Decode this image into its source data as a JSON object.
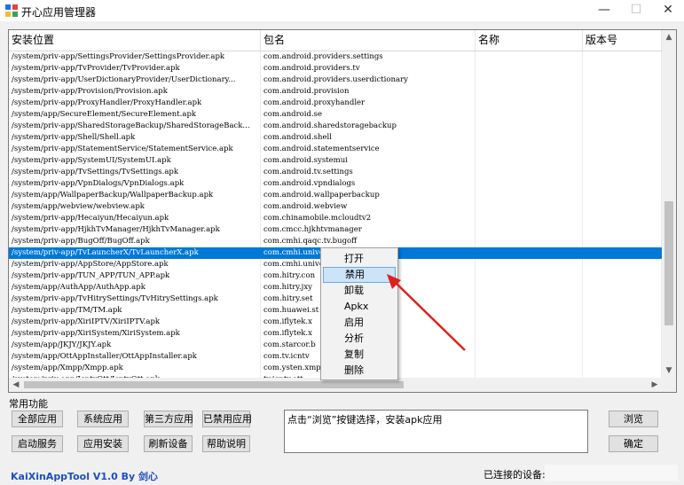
{
  "window": {
    "title": "开心应用管理器",
    "minimize": "—",
    "maximize": "☐",
    "close": "✕",
    "icon": "app-grid-icon"
  },
  "grid": {
    "columns": [
      "安装位置",
      "包名",
      "名称",
      "版本号"
    ],
    "rows": [
      {
        "path": "/system/priv-app/SettingsProvider/SettingsProvider.apk",
        "pkg": "com.android.providers.settings"
      },
      {
        "path": "/system/priv-app/TvProvider/TvProvider.apk",
        "pkg": "com.android.providers.tv"
      },
      {
        "path": "/system/priv-app/UserDictionaryProvider/UserDictionary...",
        "pkg": "com.android.providers.userdictionary"
      },
      {
        "path": "/system/priv-app/Provision/Provision.apk",
        "pkg": "com.android.provision"
      },
      {
        "path": "/system/priv-app/ProxyHandler/ProxyHandler.apk",
        "pkg": "com.android.proxyhandler"
      },
      {
        "path": "/system/app/SecureElement/SecureElement.apk",
        "pkg": "com.android.se"
      },
      {
        "path": "/system/priv-app/SharedStorageBackup/SharedStorageBack...",
        "pkg": "com.android.sharedstoragebackup"
      },
      {
        "path": "/system/priv-app/Shell/Shell.apk",
        "pkg": "com.android.shell"
      },
      {
        "path": "/system/priv-app/StatementService/StatementService.apk",
        "pkg": "com.android.statementservice"
      },
      {
        "path": "/system/priv-app/SystemUI/SystemUI.apk",
        "pkg": "com.android.systemui"
      },
      {
        "path": "/system/priv-app/TvSettings/TvSettings.apk",
        "pkg": "com.android.tv.settings"
      },
      {
        "path": "/system/priv-app/VpnDialogs/VpnDialogs.apk",
        "pkg": "com.android.vpndialogs"
      },
      {
        "path": "/system/app/WallpaperBackup/WallpaperBackup.apk",
        "pkg": "com.android.wallpaperbackup"
      },
      {
        "path": "/system/app/webview/webview.apk",
        "pkg": "com.android.webview"
      },
      {
        "path": "/system/priv-app/Hecaiyun/Hecaiyun.apk",
        "pkg": "com.chinamobile.mcloudtv2"
      },
      {
        "path": "/system/priv-app/HjkhTvManager/HjkhTvManager.apk",
        "pkg": "com.cmcc.hjkhtvmanager"
      },
      {
        "path": "/system/priv-app/BugOff/BugOff.apk",
        "pkg": "com.cmhi.qaqc.tv.bugoff"
      },
      {
        "path": "/system/priv-app/TvLauncherX/TvLauncherX.apk",
        "pkg": "com.cmhi.universalapp.launcher"
      },
      {
        "path": "/system/priv-app/AppStore/AppStore.apk",
        "pkg": "com.cmhi.universalapp.appstore"
      },
      {
        "path": "/system/priv-app/TUN_APP/TUN_APP.apk",
        "pkg": "com.hitry.con"
      },
      {
        "path": "/system/app/AuthApp/AuthApp.apk",
        "pkg": "com.hitry.jxy"
      },
      {
        "path": "/system/priv-app/TvHitrySettings/TvHitrySettings.apk",
        "pkg": "com.hitry.set"
      },
      {
        "path": "/system/priv-app/TM/TM.apk",
        "pkg": "com.huawei.st"
      },
      {
        "path": "/system/priv-app/XiriIPTV/XiriIPTV.apk",
        "pkg": "com.iflytek.x"
      },
      {
        "path": "/system/priv-app/XiriSystem/XiriSystem.apk",
        "pkg": "com.iflytek.x"
      },
      {
        "path": "/system/app/JKJY/JKJY.apk",
        "pkg": "com.starcor.b"
      },
      {
        "path": "/system/app/OttAppInstaller/OttAppInstaller.apk",
        "pkg": "com.tv.icntv"
      },
      {
        "path": "/system/app/Xmpp/Xmpp.apk",
        "pkg": "com.ysten.xmp"
      },
      {
        "path": "/system/priv-app/IcntvOtt/IcntvOtt.apk",
        "pkg": "tv.icntv.ott"
      }
    ],
    "selected_index": 17
  },
  "context_menu": {
    "items": [
      "打开",
      "禁用",
      "卸载",
      "Apkx",
      "启用",
      "分析",
      "复制",
      "删除"
    ],
    "highlighted_index": 1
  },
  "common": {
    "label": "常用功能",
    "btn_all": "全部应用",
    "btn_system": "系统应用",
    "btn_third": "第三方应用",
    "btn_disabled": "已禁用应用",
    "btn_start_service": "启动服务",
    "btn_install": "应用安装",
    "btn_refresh": "刷新设备",
    "btn_help": "帮助说明",
    "hint": "点击“浏览”按键选择，安装apk应用",
    "btn_browse": "浏览",
    "btn_ok": "确定"
  },
  "footer": {
    "brand": "KaiXinAppTool V1.0 By 剑心",
    "connected_label": "已连接的设备:"
  },
  "colors": {
    "selection": "#0078d7",
    "menu_highlight": "#cce4f7",
    "annotation_arrow": "#e02020",
    "brand": "#1e4fbf"
  }
}
